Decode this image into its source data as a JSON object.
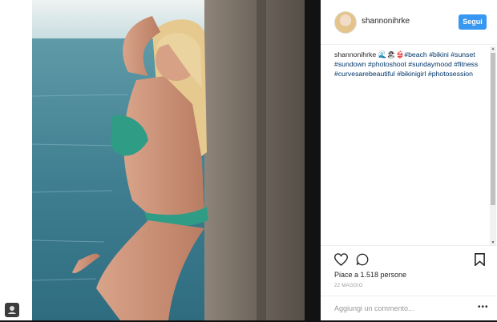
{
  "post": {
    "username": "shannonihrke",
    "follow_label": "Segui",
    "caption_user": "shannonihrke",
    "caption_emoji": "🌊🏖👙",
    "hashtags": [
      "#beach",
      "#bikini",
      "#sunset",
      "#sundown",
      "#photoshoot",
      "#sundaymood",
      "#fitness",
      "#curvesarebeautiful",
      "#bikinigirl",
      "#photosession"
    ],
    "likes_text": "Piace a 1.518 persone",
    "date_text": "22 MAGGIO",
    "comment_placeholder": "Aggiungi un commento...",
    "more_label": "•••"
  },
  "icons": {
    "like": "heart-icon",
    "comment": "comment-icon",
    "save": "bookmark-icon",
    "profile": "profile-icon"
  },
  "colors": {
    "accent": "#3897f0",
    "hashtag": "#003569",
    "backdrop": "#121212"
  }
}
